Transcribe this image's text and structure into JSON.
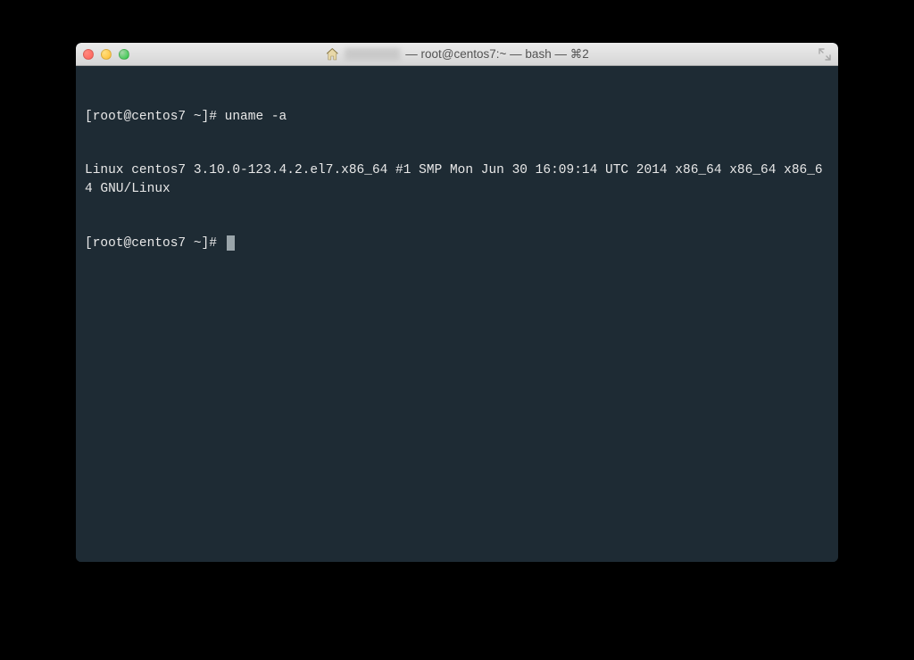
{
  "window": {
    "title_suffix": " — root@centos7:~ — bash — ⌘2"
  },
  "terminal": {
    "line1_prompt": "[root@centos7 ~]# ",
    "line1_cmd": "uname -a",
    "line2": "Linux centos7 3.10.0-123.4.2.el7.x86_64 #1 SMP Mon Jun 30 16:09:14 UTC 2014 x86_64 x86_64 x86_64 GNU/Linux",
    "line3_prompt": "[root@centos7 ~]# "
  }
}
